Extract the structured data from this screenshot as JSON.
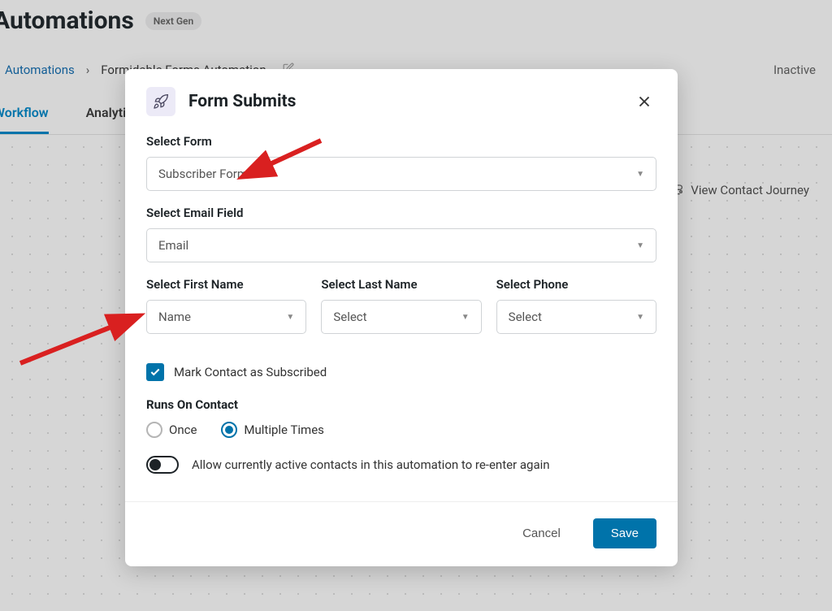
{
  "header": {
    "title": "Automations",
    "badge": "Next Gen"
  },
  "breadcrumb": {
    "link": "Automations",
    "current": "Formidable Forms Automation"
  },
  "status": "Inactive",
  "tabs": {
    "workflow": "Workflow",
    "analytics": "Analytics"
  },
  "journey": "View Contact Journey",
  "modal": {
    "title": "Form Submits",
    "fields": {
      "form_label": "Select Form",
      "form_value": "Subscriber Form",
      "email_label": "Select Email Field",
      "email_value": "Email",
      "firstname_label": "Select First Name",
      "firstname_value": "Name",
      "lastname_label": "Select Last Name",
      "lastname_value": "Select",
      "phone_label": "Select Phone",
      "phone_value": "Select"
    },
    "checkbox_label": "Mark Contact as Subscribed",
    "runs_label": "Runs On Contact",
    "radio_once": "Once",
    "radio_multiple": "Multiple Times",
    "toggle_label": "Allow currently active contacts in this automation to re-enter again",
    "cancel": "Cancel",
    "save": "Save"
  }
}
